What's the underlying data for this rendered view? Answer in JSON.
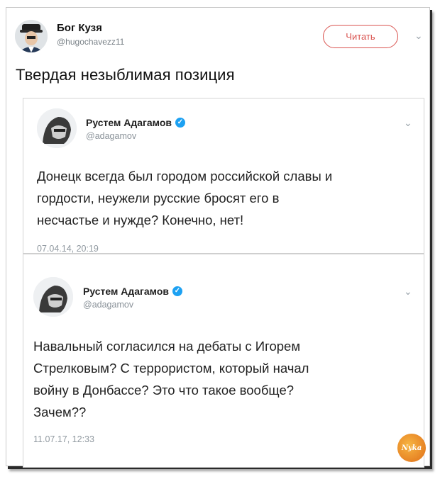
{
  "outer_tweet": {
    "author_name": "Бог Кузя",
    "author_handle": "@hugochavezz11",
    "follow_label": "Читать",
    "text": "Твердая незыблимая позиция"
  },
  "embedded_tweets": [
    {
      "author_name": "Рустем Адагамов",
      "author_handle": "@adagamov",
      "body_lines": [
        "Донецк всегда был городом российской славы и",
        "гордости, неужели русские бросят его в",
        "несчастье и нужде? Конечно, нет!"
      ],
      "timestamp": "07.04.14, 20:19"
    },
    {
      "author_name": "Рустем Адагамов",
      "author_handle": "@adagamov",
      "body_lines": [
        "Навальный согласился на дебаты с Игорем",
        "Стрелковым? С террористом, который начал",
        "войну в Донбассе? Это что такое вообще?",
        "Зачем??"
      ],
      "timestamp": "11.07.17, 12:33"
    }
  ],
  "icons": {
    "verified": "verified-badge-icon",
    "caret": "chevron-down-icon"
  },
  "colors": {
    "follow_accent": "#d9534f",
    "verified_blue": "#1da1f2"
  }
}
